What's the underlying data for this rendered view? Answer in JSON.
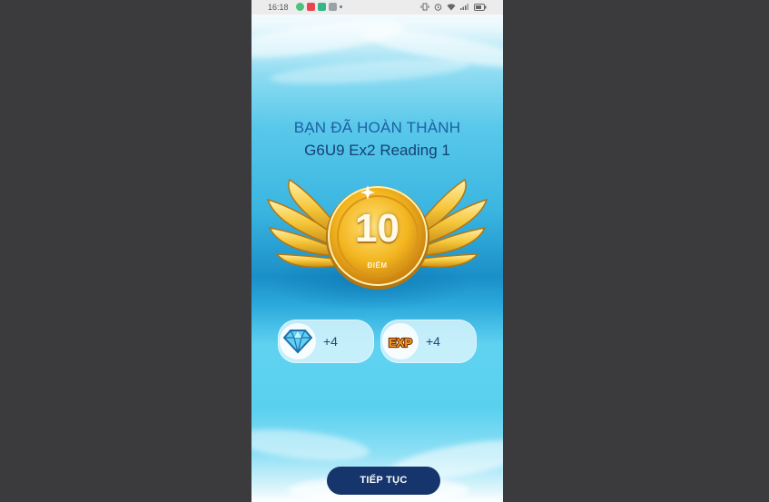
{
  "status_bar": {
    "time": "16:18",
    "notification_icons": [
      "messenger-icon",
      "music-icon",
      "app-icon",
      "gallery-icon"
    ],
    "system_icons": [
      "vibrate-icon",
      "alarm-icon",
      "wifi-icon",
      "signal-icon",
      "battery-icon"
    ]
  },
  "result": {
    "heading": "BẠN ĐÃ HOÀN THÀNH",
    "lesson": "G6U9 Ex2 Reading 1"
  },
  "medal": {
    "score": "10",
    "label": "ĐIỂM"
  },
  "rewards": [
    {
      "icon": "diamond-icon",
      "value": "+4"
    },
    {
      "icon": "exp-icon",
      "icon_text": "EXP",
      "value": "+4"
    }
  ],
  "actions": {
    "continue_label": "TIẾP TỤC"
  },
  "colors": {
    "page_background": "#3b3b3d",
    "button": "#15356c",
    "gold": "#f5b820",
    "ocean_top": "#8fdcf2",
    "ocean_deep": "#1a8fc8"
  }
}
